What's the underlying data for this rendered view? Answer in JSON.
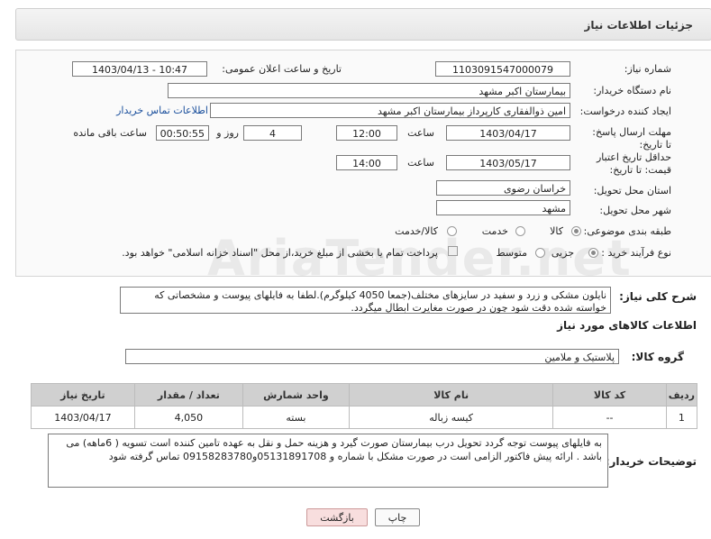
{
  "header": {
    "title": "جزئیات اطلاعات نیاز"
  },
  "fields": {
    "need_number_label": "شماره نیاز:",
    "need_number": "1103091547000079",
    "announce_label": "تاریخ و ساعت اعلان عمومی:",
    "announce_value": "1403/04/13 - 10:47",
    "buyer_org_label": "نام دستگاه خریدار:",
    "buyer_org": "بیمارستان اکبر مشهد",
    "creator_label": "ایجاد کننده درخواست:",
    "creator": "امین ذوالفقاری کارپرداز بیمارستان اکبر مشهد",
    "contact_link": "اطلاعات تماس خریدار",
    "deadline_label": "مهلت ارسال پاسخ: تا تاریخ:",
    "deadline_date": "1403/04/17",
    "time_label": "ساعت",
    "deadline_time": "12:00",
    "days_value": "4",
    "days_label": "روز و",
    "remaining_time": "00:50:55",
    "remaining_label": "ساعت باقی مانده",
    "validity_label": "حداقل تاریخ اعتبار قیمت: تا تاریخ:",
    "validity_date": "1403/05/17",
    "validity_time": "14:00",
    "province_label": "استان محل تحویل:",
    "province": "خراسان رضوی",
    "city_label": "شهر محل تحویل:",
    "city": "مشهد",
    "category_label": "طبقه بندی موضوعی:",
    "cat_goods": "کالا",
    "cat_service": "خدمت",
    "cat_goods_service": "کالا/خدمت",
    "process_label": "نوع فرآیند خرید :",
    "proc_partial": "جزیی",
    "proc_medium": "متوسط",
    "payment_note": "پرداخت تمام یا بخشی از مبلغ خرید،از محل \"اسناد خزانه اسلامی\" خواهد بود."
  },
  "description": {
    "label": "شرح کلی نیاز:",
    "text": "نایلون مشکی و زرد و سفید در سایزهای مختلف(جمعا 4050 کیلوگرم).لطفا به فایلهای پیوست و مشخصاتی که خواسته شده دقت شود چون در صورت مغایرت ابطال میگردد."
  },
  "goods_info_title": "اطلاعات کالاهای مورد نیاز",
  "goods_group": {
    "label": "گروه کالا:",
    "value": "پلاستیک و ملامین"
  },
  "table": {
    "headers": [
      "ردیف",
      "کد کالا",
      "نام کالا",
      "واحد شمارش",
      "تعداد / مقدار",
      "تاریخ نیاز"
    ],
    "rows": [
      [
        "1",
        "--",
        "کیسه زباله",
        "بسته",
        "4,050",
        "1403/04/17"
      ]
    ]
  },
  "buyer_notes": {
    "label": "توضیحات خریدار:",
    "text": "به فایلهای پیوست توجه گردد تحویل درب بیمارستان صورت گیرد و هزینه حمل و نقل به عهده تامین کننده است تسویه ( 6ماهه) می باشد . ارائه پیش فاکتور الزامی است در صورت مشکل با شماره و 05131891708و09158283780 تماس گرفته شود"
  },
  "buttons": {
    "print": "چاپ",
    "back": "بازگشت"
  },
  "watermark": "AriaTender.net"
}
